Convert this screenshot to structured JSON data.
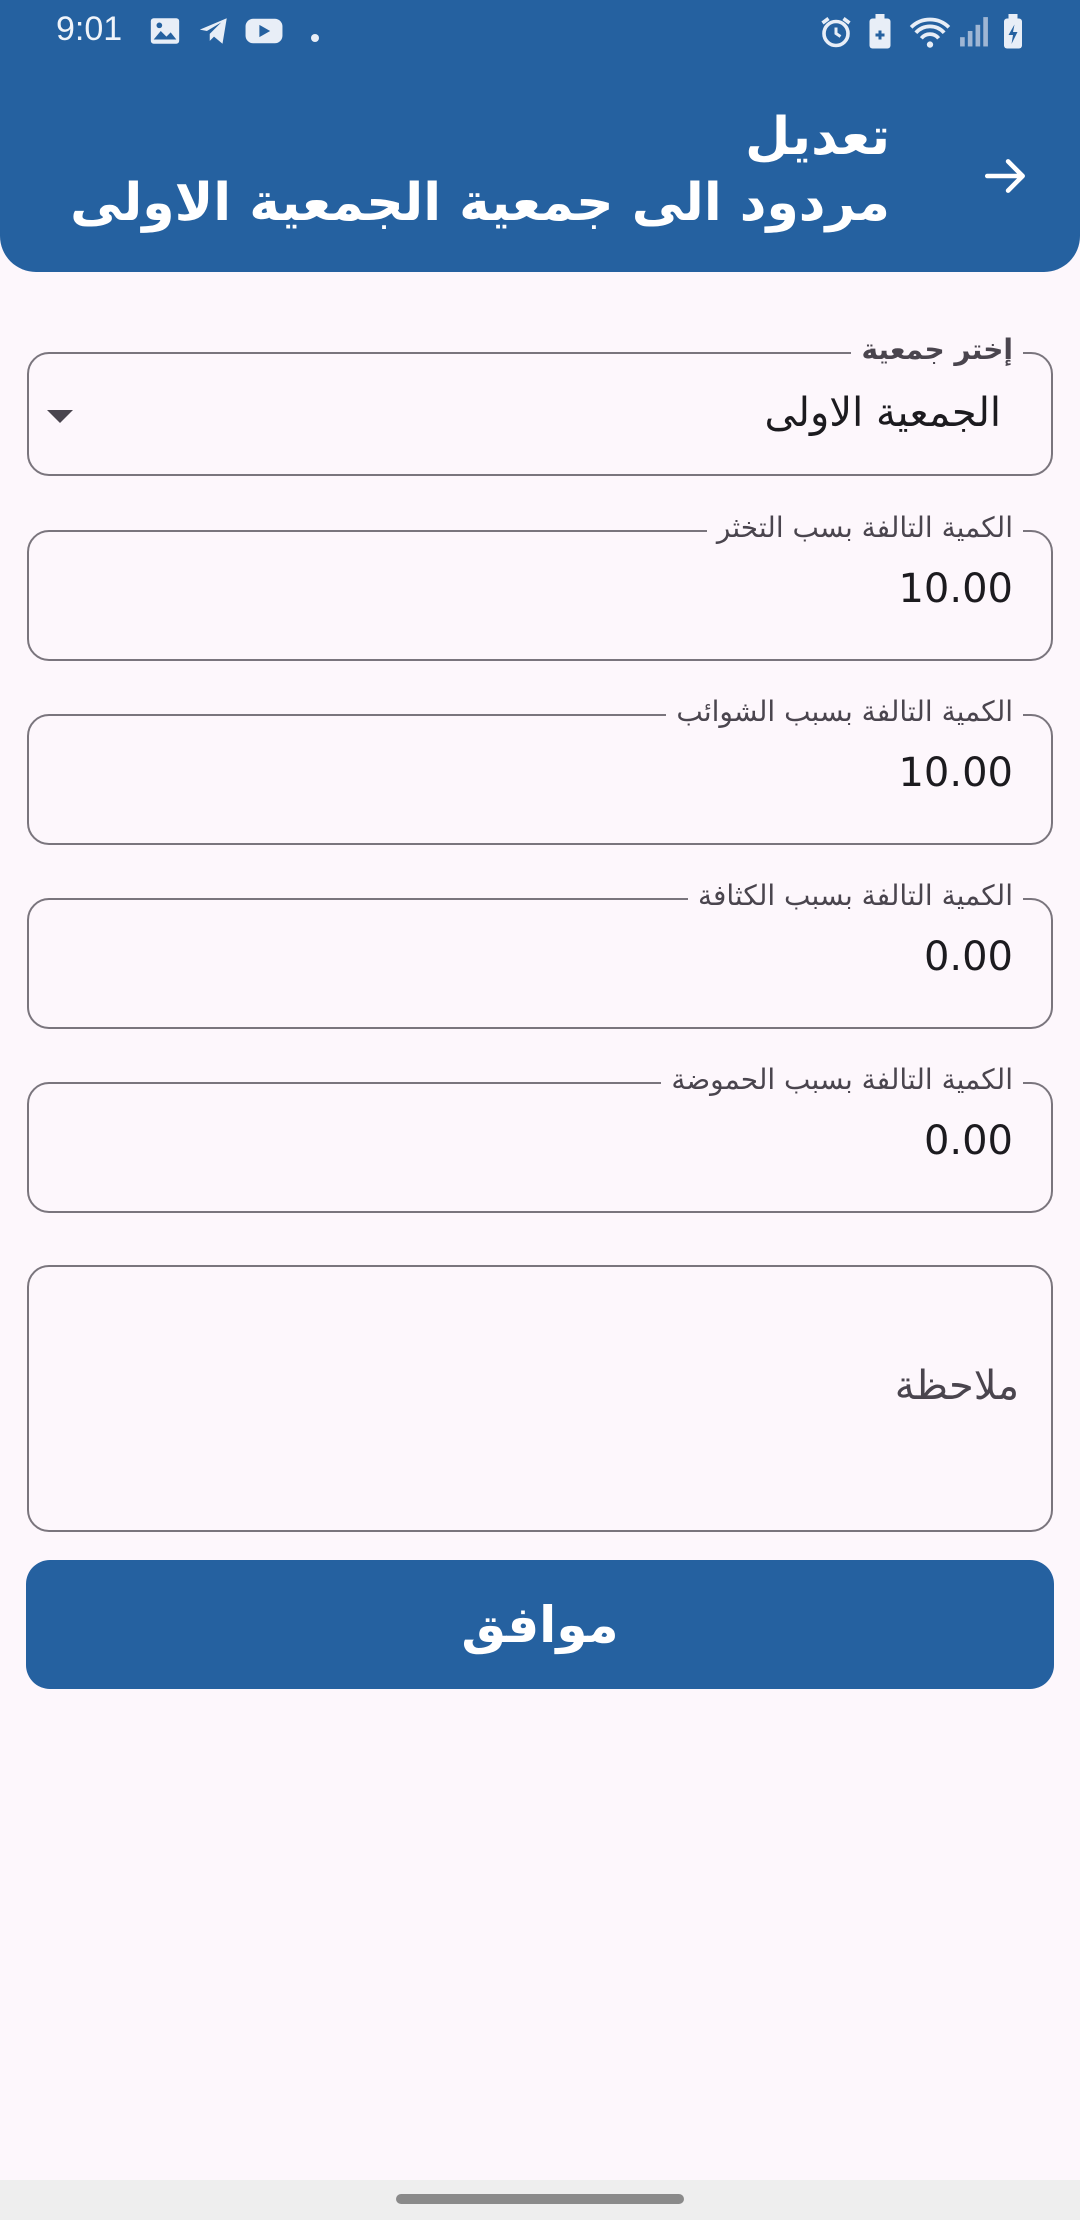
{
  "status_bar": {
    "time": "9:01",
    "left_icons": [
      "image-icon",
      "telegram-icon",
      "youtube-icon",
      "dot-icon"
    ],
    "right_icons": [
      "alarm-icon",
      "battery-saver-icon",
      "wifi-icon",
      "signal-icon",
      "battery-charging-icon"
    ]
  },
  "header": {
    "title_line1": "تعديل",
    "title_line2": "مردود الى جمعية الجمعية الاولى",
    "back_icon": "arrow-right-icon"
  },
  "form": {
    "association": {
      "label": "إختر جمعية",
      "value": "الجمعية الاولى"
    },
    "fields": [
      {
        "label": "الكمية التالفة بسب التخثر",
        "value": "10.00"
      },
      {
        "label": "الكمية التالفة بسبب الشوائب",
        "value": "10.00"
      },
      {
        "label": "الكمية التالفة بسبب الكثافة",
        "value": "0.00"
      },
      {
        "label": "الكمية التالفة بسبب الحموضة",
        "value": "0.00"
      }
    ],
    "note": {
      "placeholder": "ملاحظة"
    },
    "submit_label": "موافق"
  },
  "colors": {
    "primary": "#2561a0",
    "background": "#fdf7fc",
    "outline": "#7a757d"
  }
}
